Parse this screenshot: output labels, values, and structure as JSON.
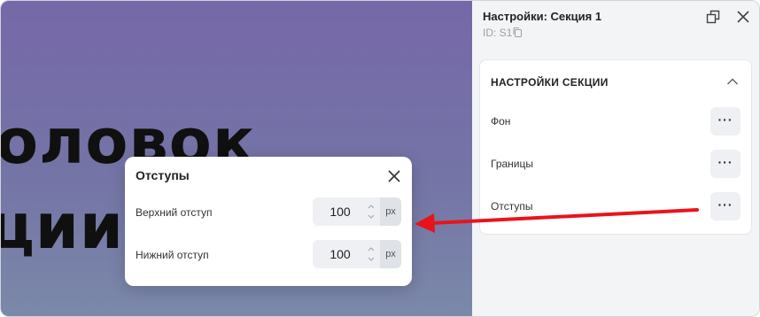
{
  "canvas": {
    "heading_line1": "оловок",
    "heading_line2": "ции"
  },
  "popup": {
    "title": "Отступы",
    "fields": [
      {
        "label": "Верхний отступ",
        "value": "100",
        "unit": "px"
      },
      {
        "label": "Нижний отступ",
        "value": "100",
        "unit": "px"
      }
    ]
  },
  "panel": {
    "title": "Настройки: Секция 1",
    "id": "ID: S1",
    "section_title": "НАСТРОЙКИ СЕКЦИИ",
    "rows": [
      {
        "label": "Фон",
        "button": "···"
      },
      {
        "label": "Границы",
        "button": "···"
      },
      {
        "label": "Отступы",
        "button": "···"
      }
    ]
  },
  "colors": {
    "annotation_arrow": "#e8141c",
    "canvas_top": "#7668a8",
    "canvas_bottom": "#7b89a9"
  },
  "icons": [
    "detach-window-icon",
    "close-icon",
    "copy-icon",
    "chevron-up-icon",
    "spin-up-icon",
    "spin-down-icon"
  ]
}
